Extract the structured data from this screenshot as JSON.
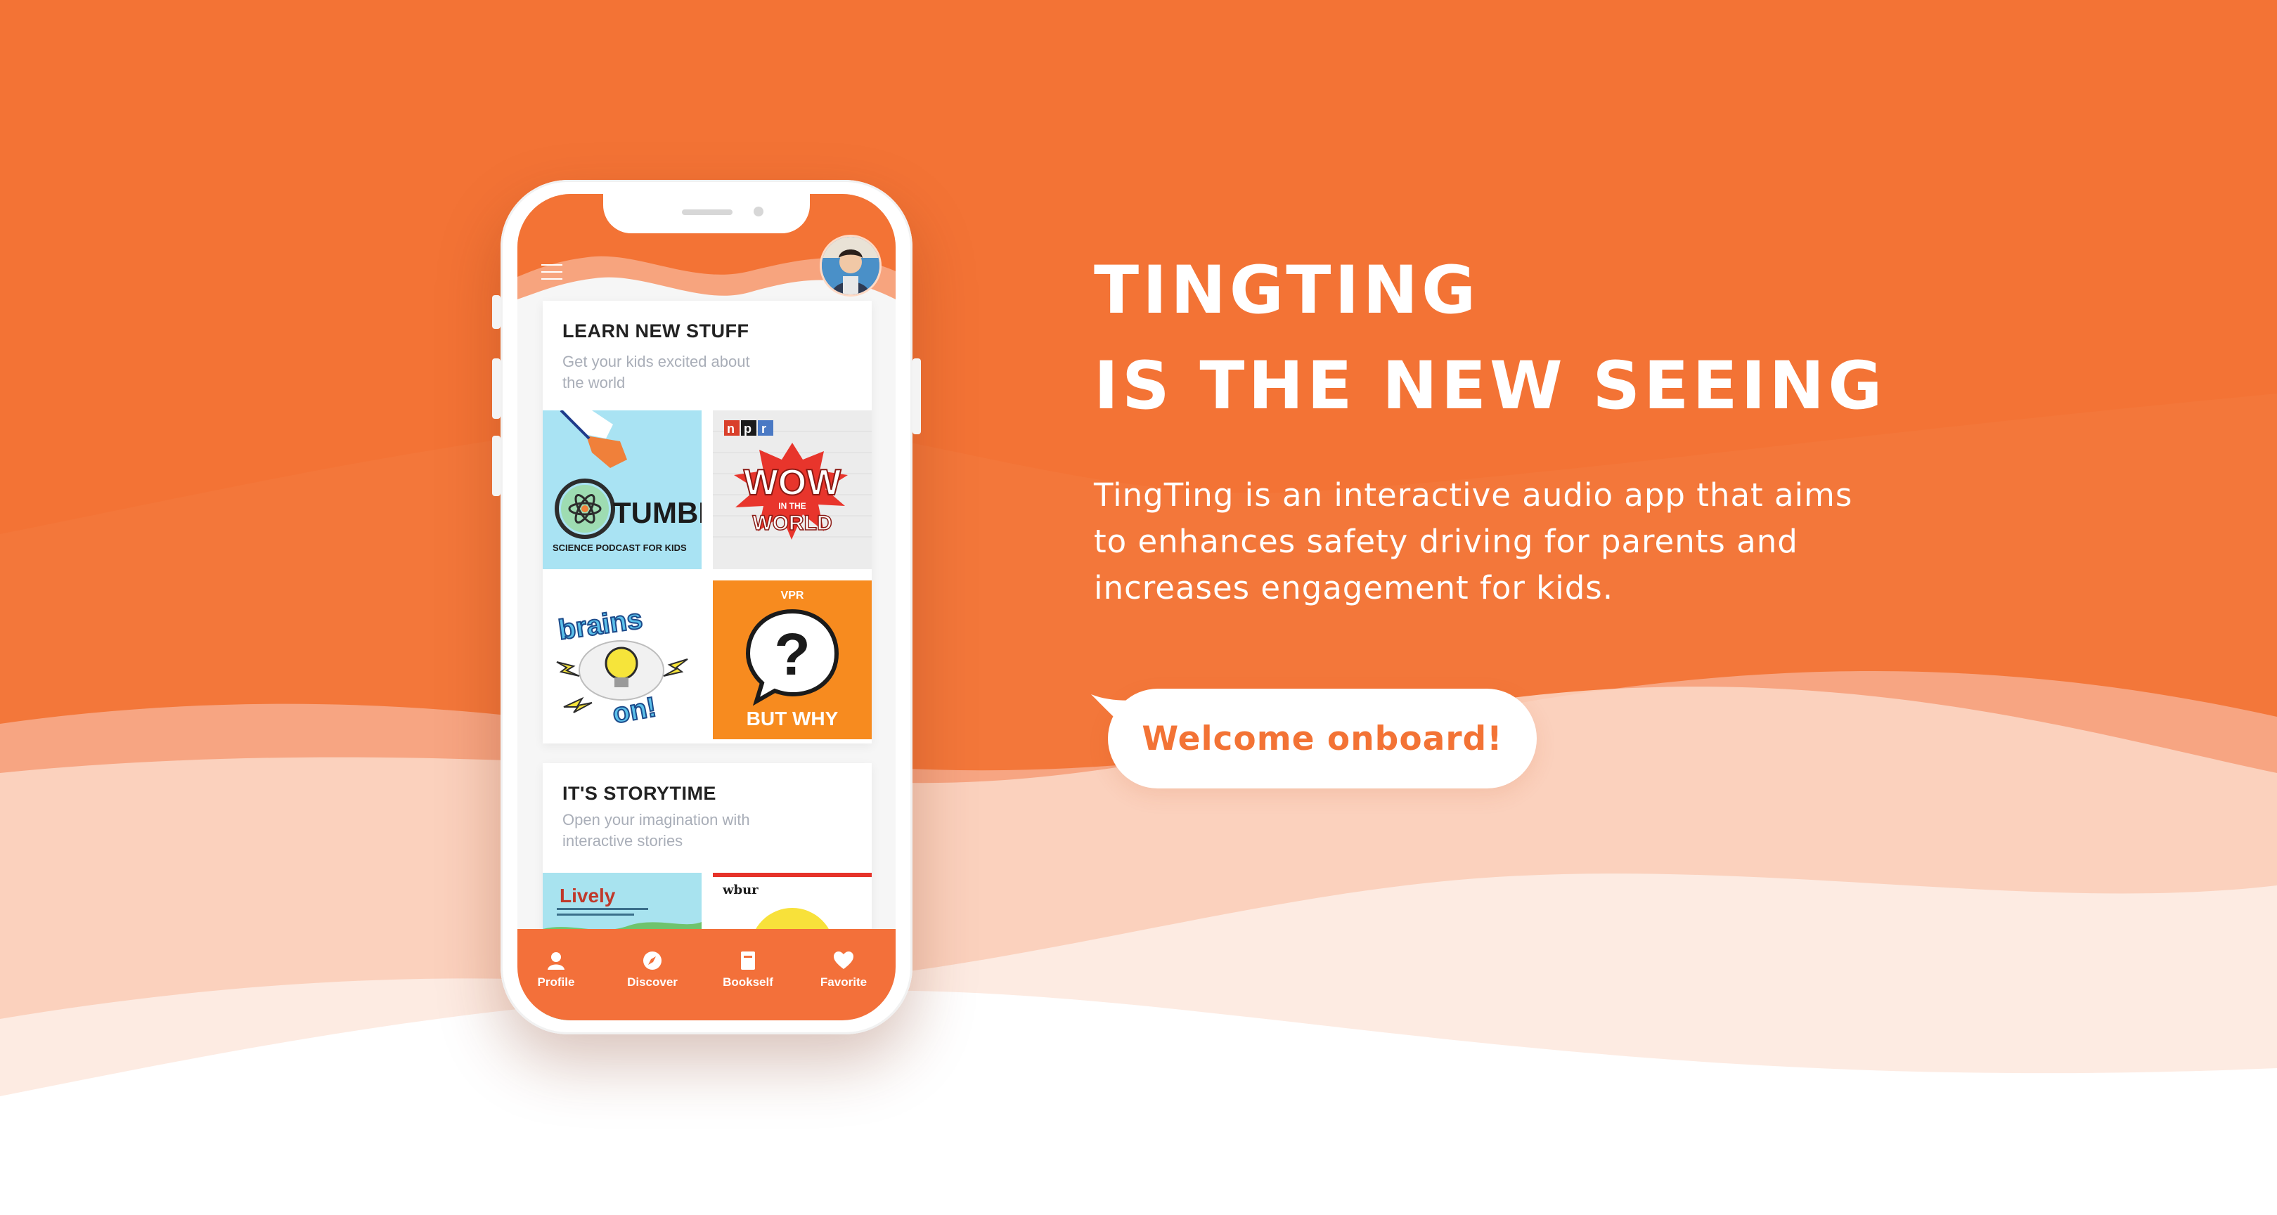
{
  "colors": {
    "brand_orange": "#f37335",
    "accent_orange": "#f3703a",
    "light_peach": "#fbe4d9",
    "white": "#ffffff"
  },
  "app": {
    "menu_icon": "hamburger-menu-icon",
    "sections": [
      {
        "title": "LEARN NEW STUFF",
        "subtitle": "Get your kids excited about the world",
        "tiles": [
          {
            "name": "tumble",
            "label": "TUMBLE",
            "sub_label": "SCIENCE PODCAST FOR KIDS"
          },
          {
            "name": "wow-in-the-world",
            "brand": "npr",
            "label": "WOW",
            "in_the": "IN THE",
            "label2": "WORLD"
          },
          {
            "name": "brains-on",
            "label": "brains",
            "label2": "on!"
          },
          {
            "name": "but-why",
            "brand": "VPR",
            "label": "BUT WHY",
            "glyph": "?"
          }
        ]
      },
      {
        "title": "IT'S STORYTIME",
        "subtitle": "Open your imagination with interactive stories",
        "tiles": [
          {
            "name": "lively",
            "label": "Lively"
          },
          {
            "name": "wbur",
            "brand": "wbur"
          }
        ]
      }
    ],
    "tabs": [
      {
        "label": "Profile",
        "icon": "profile-icon"
      },
      {
        "label": "Discover",
        "icon": "compass-icon"
      },
      {
        "label": "Bookself",
        "icon": "book-icon"
      },
      {
        "label": "Favorite",
        "icon": "heart-icon"
      }
    ]
  },
  "hero": {
    "headline_line1": "TINGTING",
    "headline_line2": "IS THE NEW SEEING",
    "description": "TingTing is an interactive audio app that aims to enhances safety driving for parents and increases engagement for kids.",
    "cta_label": "Welcome onboard!"
  }
}
